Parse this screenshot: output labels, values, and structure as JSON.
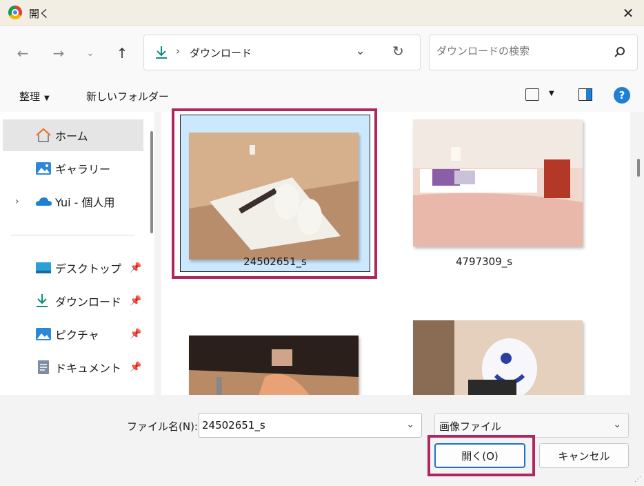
{
  "window": {
    "title": "開く"
  },
  "address": {
    "crumb": "ダウンロード",
    "separator": "›"
  },
  "search": {
    "placeholder": "ダウンロードの検索"
  },
  "toolbar": {
    "organize": "整理",
    "new_folder": "新しいフォルダー"
  },
  "sidebar": {
    "items": [
      {
        "label": "ホーム",
        "icon": "home-icon"
      },
      {
        "label": "ギャラリー",
        "icon": "gallery-icon"
      },
      {
        "label": "Yui - 個人用",
        "icon": "onedrive-icon"
      },
      {
        "label": "デスクトップ",
        "icon": "desktop-icon"
      },
      {
        "label": "ダウンロード",
        "icon": "download-icon"
      },
      {
        "label": "ピクチャ",
        "icon": "pictures-icon"
      },
      {
        "label": "ドキュメント",
        "icon": "documents-icon"
      }
    ]
  },
  "files": [
    {
      "name": "24502651_s",
      "selected": true
    },
    {
      "name": "4797309_s",
      "selected": false
    },
    {
      "name": "",
      "selected": false
    },
    {
      "name": "",
      "selected": false
    }
  ],
  "footer": {
    "filename_label": "ファイル名(N):",
    "filename_value": "24502651_s",
    "filetype": "画像ファイル",
    "open_button": "開く(O)",
    "cancel_button": "キャンセル"
  },
  "colors": {
    "accent": "#1e7fd6",
    "selection": "#cce8ff",
    "highlight": "#b0275f"
  }
}
